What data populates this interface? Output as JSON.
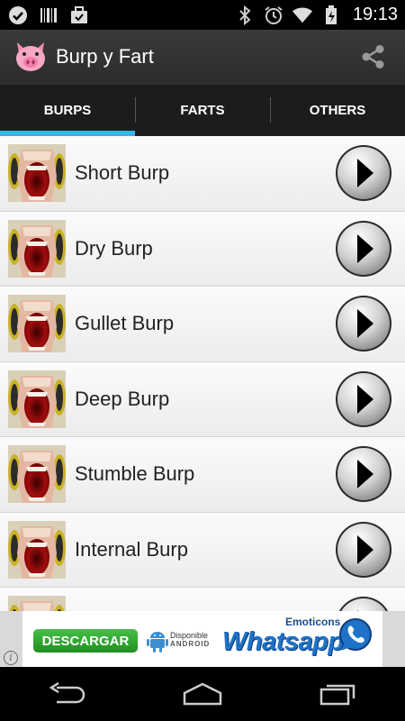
{
  "status_bar": {
    "left_icons": [
      "check-circle-icon",
      "barcode-icon",
      "briefcase-icon"
    ],
    "right_icons": [
      "bluetooth-icon",
      "alarm-icon",
      "wifi-icon",
      "battery-icon"
    ],
    "time": "19:13"
  },
  "action_bar": {
    "title": "Burp y Fart",
    "app_icon": "pig-icon",
    "share_icon": "share-icon"
  },
  "tabs": [
    {
      "label": "BURPS",
      "active": true
    },
    {
      "label": "FARTS",
      "active": false
    },
    {
      "label": "OTHERS",
      "active": false
    }
  ],
  "sounds": [
    {
      "label": "Short Burp"
    },
    {
      "label": "Dry Burp"
    },
    {
      "label": "Gullet Burp"
    },
    {
      "label": "Deep Burp"
    },
    {
      "label": "Stumble Burp"
    },
    {
      "label": "Internal Burp"
    },
    {
      "label": ""
    }
  ],
  "ad": {
    "download_label": "DESCARGAR",
    "available_label": "Disponible",
    "platform_label": "ANDROID",
    "tagline": "Emoticons",
    "brand": "Whatsapp",
    "info_label": "i"
  },
  "nav_bar": {
    "icons": [
      "back-icon",
      "home-icon",
      "recent-apps-icon"
    ]
  },
  "colors": {
    "accent": "#33b5e5",
    "action_bar": "#333333",
    "tab_bar": "#1c1c1c"
  }
}
